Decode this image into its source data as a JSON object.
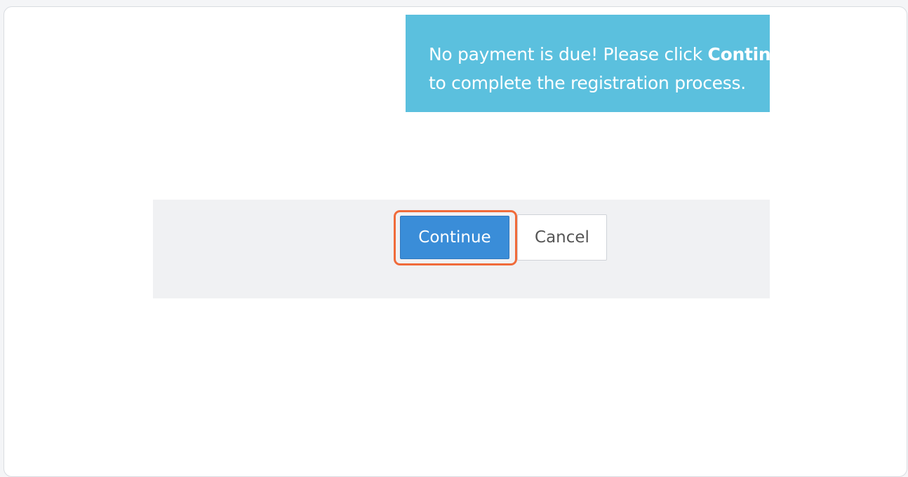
{
  "alert": {
    "line1_prefix": "No payment is due! Please click ",
    "line1_bold": "Continue",
    "line1_suffix": " ",
    "line2": "to complete the registration process."
  },
  "actions": {
    "continue_label": "Continue",
    "cancel_label": "Cancel"
  },
  "colors": {
    "alert_bg": "#5bc0de",
    "primary": "#3a8dd8",
    "highlight": "#f06b3a"
  }
}
